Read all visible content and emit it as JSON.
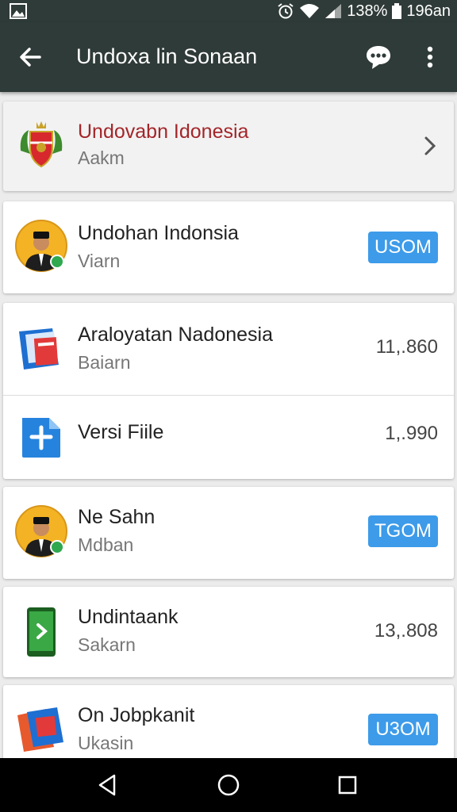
{
  "status_bar": {
    "battery_text": "138%",
    "time": "196an"
  },
  "app_bar": {
    "title": "Undoxa lin Sonaan"
  },
  "featured": {
    "title": "Undovabn Idonesia",
    "subtitle": "Aakm"
  },
  "items": [
    {
      "title": "Undohan Indonsia",
      "subtitle": "Viarn",
      "button": "USOM"
    },
    {
      "title": "Araloyatan Nadonesia",
      "subtitle": "Baiarn",
      "value": "11,.860"
    },
    {
      "title": "Versi Fiile",
      "subtitle": "",
      "value": "1,.990"
    },
    {
      "title": "Ne Sahn",
      "subtitle": "Mdban",
      "button": "TGOM"
    },
    {
      "title": "Undintaank",
      "subtitle": "Sakarn",
      "value": "13,.808"
    },
    {
      "title": "On Jobpkanit",
      "subtitle": "Ukasin",
      "button": "U3OM"
    }
  ],
  "colors": {
    "app_bar": "#2f3b38",
    "accent_button": "#3d9be9",
    "featured_title": "#a3262a"
  },
  "icons": [
    "gallery-icon",
    "alarm-icon",
    "wifi-icon",
    "signal-icon",
    "battery-icon",
    "back-arrow-icon",
    "chat-icon",
    "more-vert-icon",
    "chevron-right-icon",
    "nav-back-icon",
    "nav-home-icon",
    "nav-recents-icon"
  ]
}
